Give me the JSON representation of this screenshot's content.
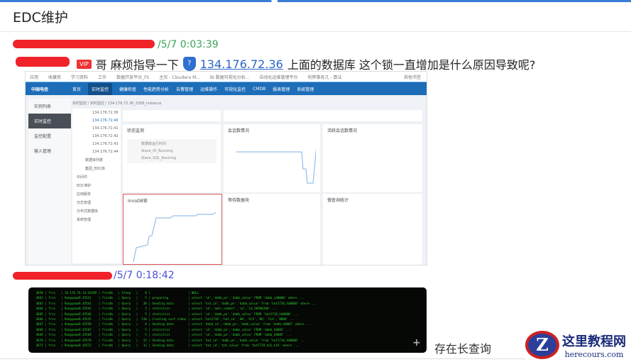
{
  "header": {
    "title": "EDC维护"
  },
  "messages": [
    {
      "timestamp": "/5/7 0:03:39",
      "text_prefix": "哥 麻烦指导一下",
      "ip_link": "134.176.72.36",
      "text_suffix": "上面的数据库  这个锁一直增加是什么原因导致呢?",
      "mention_badge": "VIP"
    },
    {
      "timestamp": "/5/7 0:18:42",
      "caption": "存在长查询"
    }
  ],
  "embedded_screenshot": {
    "bookmarks": [
      "应用",
      "收藏夹",
      "学习资料",
      "工作",
      "数据开放平台_FS",
      "主页 - Cloudera M...",
      "BI 数据可视化分析...",
      "自动化运维管理平台",
      "利弊事务几 - 算法",
      "其他书签"
    ],
    "nav": [
      "首页",
      "实时监控",
      "健康检查",
      "性能趋势分析",
      "告警管理",
      "运维操作",
      "可视化监控",
      "CMDB",
      "报表管理",
      "系统管理"
    ],
    "sidebar": [
      "实例列表",
      "实时监控",
      "监控配置",
      "输入管理"
    ],
    "breadcrumb": "实时监控 / 实时监控 / 134.176.72.36_3306_Instance",
    "tree": [
      "134.176.72.36",
      "134.176.72.40",
      "134.176.72.41",
      "134.176.72.42",
      "134.176.72.43",
      "134.176.72.44",
      "数据库列表",
      "集团_EDC库",
      "中间件",
      "EDC维护",
      "应用服务",
      "日志管理",
      "分布式数据库",
      "系统管理"
    ],
    "panels": [
      "状态监测",
      "会话数情况",
      "活跃会话数情况",
      "InnoDB锁",
      "等待数据块",
      "慢查询统计"
    ],
    "status_rows": [
      "数据库运行时间",
      "Slave_IO_Running",
      "Slave_SQL_Running"
    ]
  },
  "terminal_lines": [
    " 3659 | frss   | 10.176.76.14:43189 | frssdb   | Sleep   |    0 |                     | NULL",
    " 3662 | frss   | 9anppoaw9.45531    | frssdb   | Query   |    5 | preparing           | select 'id','dabb_pn','dabb_value' FROM 'dabb_sd0000' where ...",
    " 3663 | frss   | 9anppoaw9.45541    | frssdb   | Query   |   30 | Sending data        | select 'hat_id','dabb_pn','dabb_value' from 'hat1710_hd0000' where ...",
    " 3664 | frss   | 9anppoaw9.45545    | frssdb   | Query   |    5 | statistics          | select 'id','amtr_commit','id','id_20500200' ...",
    " 3665 | frss   | 9anppoaw9.45546    | frssdb   | Query   |    5 | statistics          | select 'id','dabb_pn','dabb_value' FROM 'hat1710_hd0000' ...",
    " 3666 | frss   | 9anppoaw9.45555    | frssdb   | Query   |  110 | Creating sort index | select 'hat1710','hat_id','HH','CLS','HH','CLS','8008' ...",
    " 3667 | frss   | 9anppoaw9.45558    | frssdb   | Query   |    8 | Sending data        | select 'dabb_id','dabb_pn','dabb_value' from 'dabb_h0005' where ...",
    " 3668 | frss   | 9anppoaw9.45567    | frssdb   | Query   |    5 | statistics          | select 'id','dabb_pn','dabb_value' FROM 'dabb_h0005' ...",
    " 3669 | frss   | 9anppoaw9.45569    | frssdb   | Query   |    5 | statistics          | select 'id','dabb_pn','dabb_value' FROM 'dabb_h0005' ...",
    " 3670 | frss   | 9anppoaw9.45570    | frssdb   | Query   |   15 | Sending data        | select 'hat_id','dabb_pn','dabb_value' from 'hat1710_hd0000' ...",
    " 3671 | frss   | 9anppoaw9.45573    | frssdb   | Query   |   11 | Sending data        | select 'hat_id','hat_value' from 'hat1710_hd1_h16' where ..."
  ],
  "watermark": {
    "name": "这里教程网",
    "domain": "herecours.com",
    "logo_letter": "Z"
  },
  "colors": {
    "timestamp1": "#3aa357",
    "timestamp2": "#4a4fd8",
    "link": "#2a64c8",
    "redaction": "#f0222a"
  }
}
